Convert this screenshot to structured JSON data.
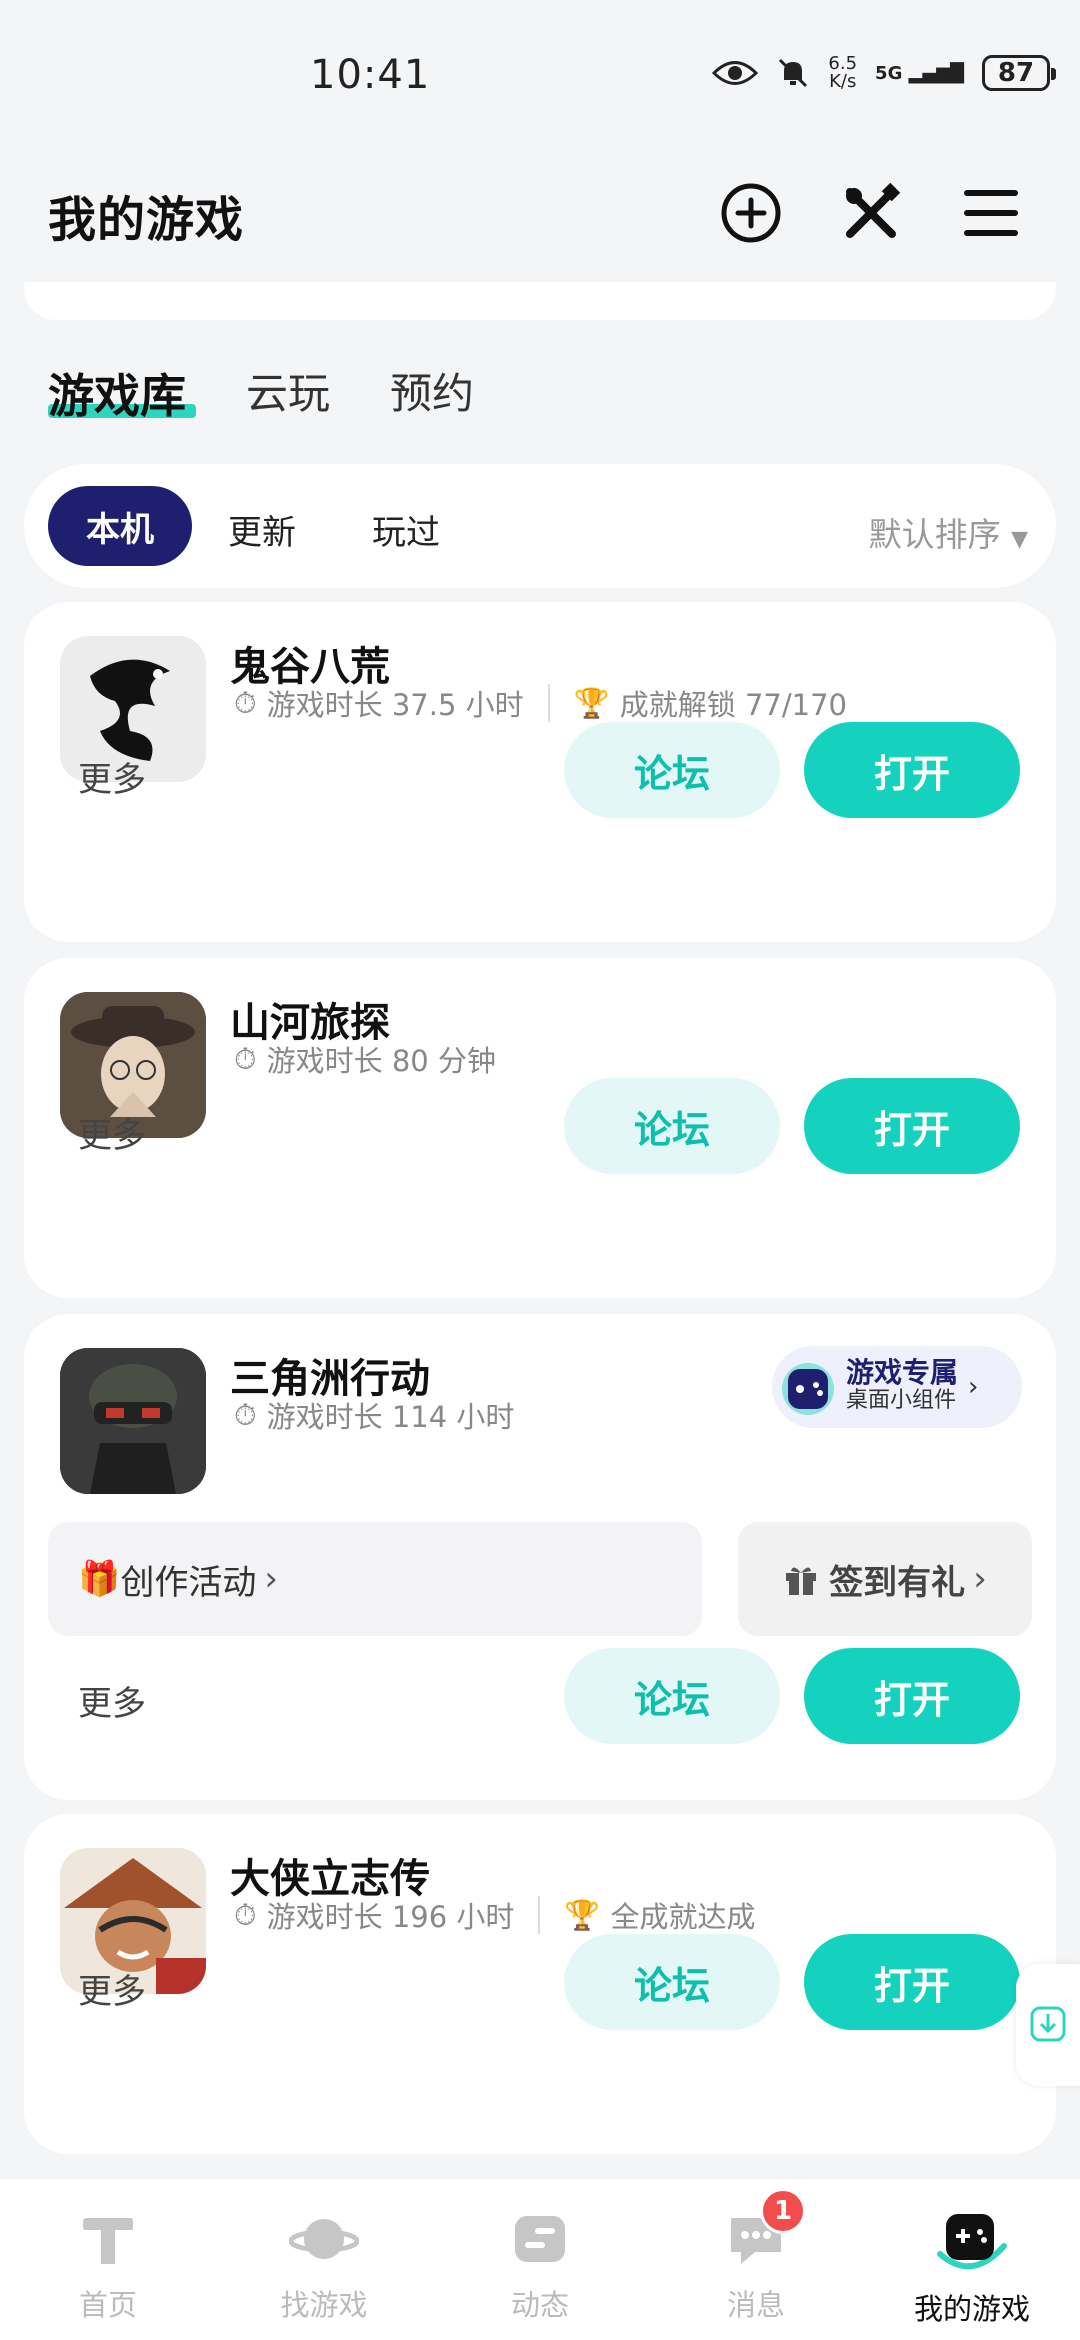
{
  "status": {
    "time": "10:41",
    "net_speed_top": "6.5",
    "net_speed_bottom": "K/s",
    "network": "5G",
    "battery": "87"
  },
  "header": {
    "title": "我的游戏"
  },
  "main_tabs": [
    {
      "label": "游戏库",
      "active": true
    },
    {
      "label": "云玩"
    },
    {
      "label": "预约"
    }
  ],
  "sub_tabs": [
    {
      "label": "本机",
      "active": true
    },
    {
      "label": "更新"
    },
    {
      "label": "玩过"
    }
  ],
  "sort_label": "默认排序",
  "games": [
    {
      "name": "鬼谷八荒",
      "playtime": "游戏时长 37.5 小时",
      "achievement": "成就解锁 77/170",
      "more": "更多",
      "forum": "论坛",
      "open": "打开"
    },
    {
      "name": "山河旅探",
      "playtime": "游戏时长 80 分钟",
      "more": "更多",
      "forum": "论坛",
      "open": "打开"
    },
    {
      "name": "三角洲行动",
      "playtime": "游戏时长 114 小时",
      "widget_line1": "游戏专属",
      "widget_line2": "桌面小组件",
      "chip_activity": "创作活动",
      "chip_signin": "签到有礼",
      "more": "更多",
      "forum": "论坛",
      "open": "打开"
    },
    {
      "name": "大侠立志传",
      "playtime": "游戏时长 196 小时",
      "achievement": "全成就达成",
      "more": "更多",
      "forum": "论坛",
      "open": "打开"
    }
  ],
  "nav": [
    {
      "label": "首页"
    },
    {
      "label": "找游戏"
    },
    {
      "label": "动态"
    },
    {
      "label": "消息",
      "badge": "1"
    },
    {
      "label": "我的游戏",
      "active": true
    }
  ],
  "colors": {
    "accent": "#14d2bd",
    "pill": "#1e1f6e",
    "badge": "#f24c4c"
  }
}
